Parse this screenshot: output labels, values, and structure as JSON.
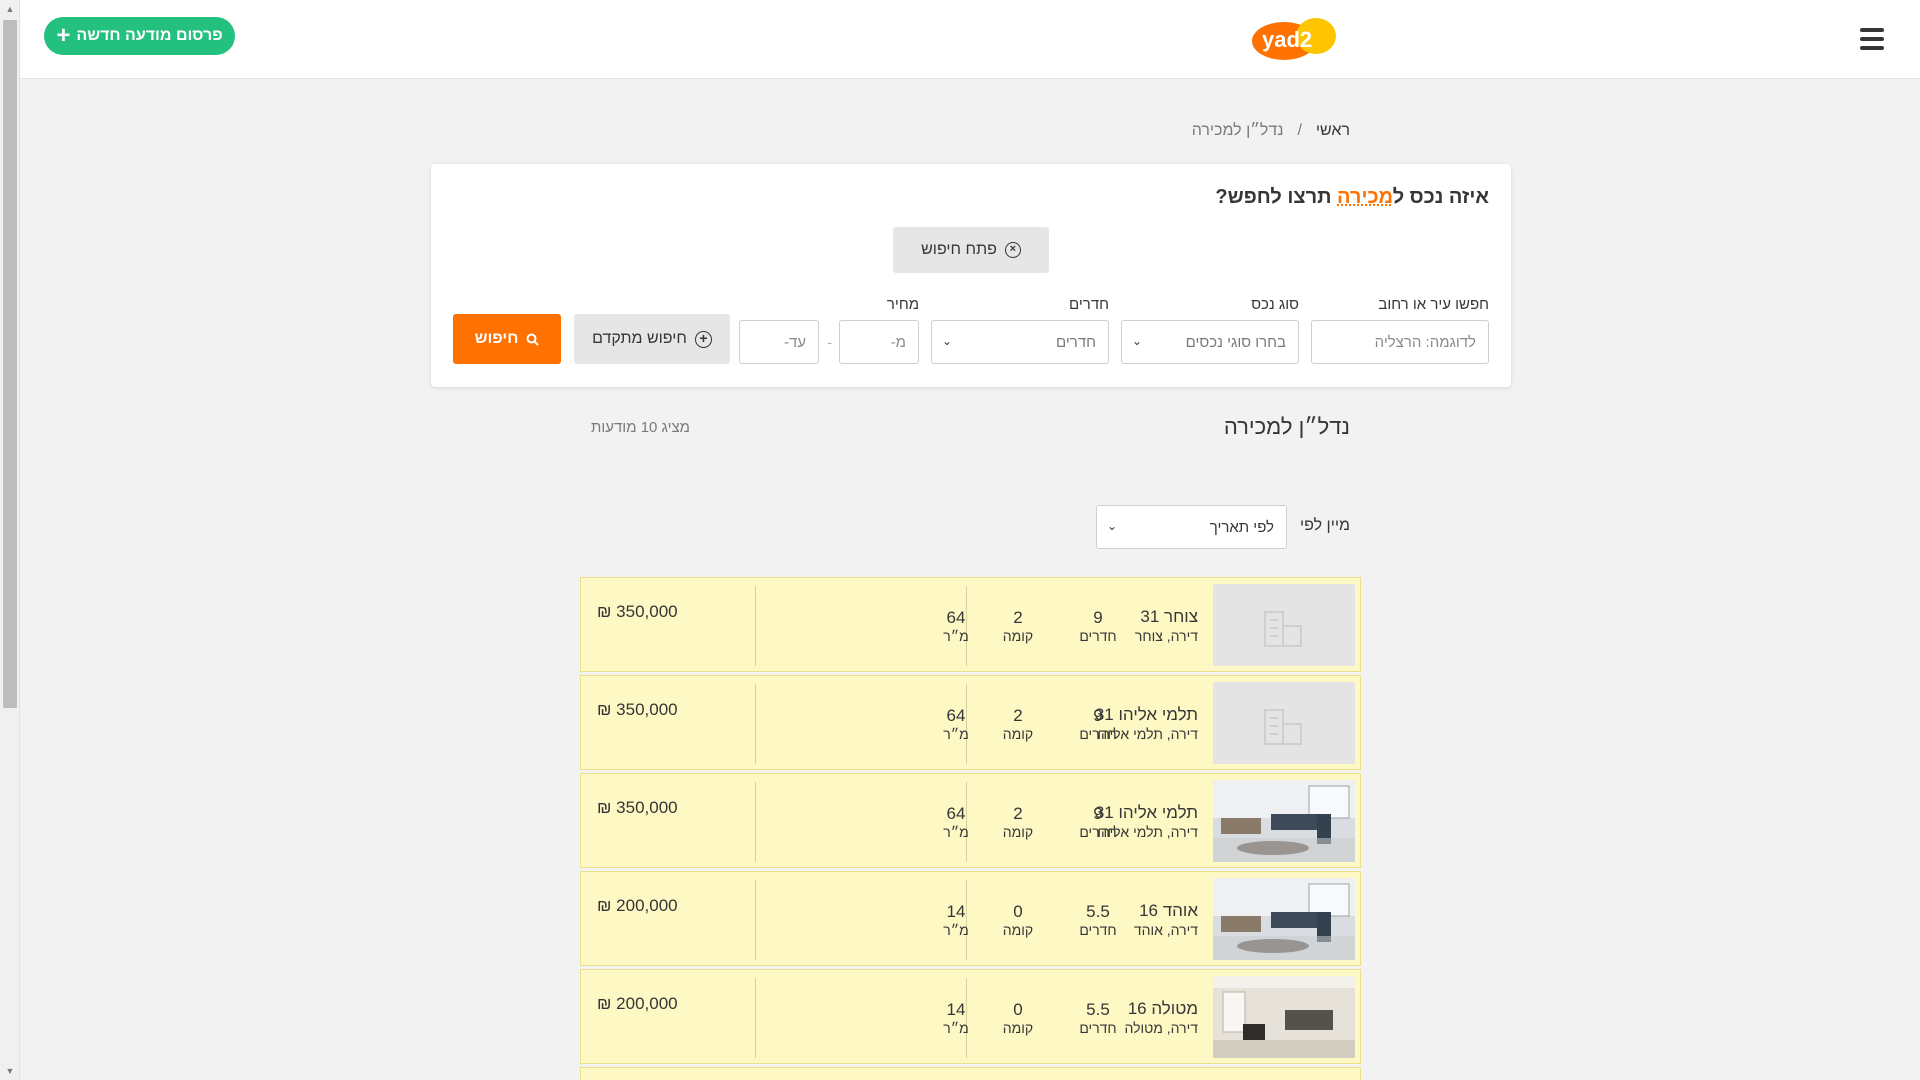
{
  "header": {
    "publish_label": "פרסום מודעה חדשה",
    "logo_text": "yad2"
  },
  "breadcrumb": {
    "home": "ראשי",
    "separator": "/",
    "current": "נדל״ן למכירה"
  },
  "search": {
    "title_prefix": "איזה נכס ל",
    "title_highlight": "מכירה",
    "title_suffix": " תרצו לחפש?",
    "open_search_label": "פתח חיפוש",
    "city_label": "חפשו עיר או רחוב",
    "city_placeholder": "לדוגמה: הרצליה",
    "type_label": "סוג נכס",
    "type_value": "בחרו סוגי נכסים",
    "rooms_label": "חדרים",
    "rooms_value": "חדרים",
    "price_label": "מחיר",
    "price_from_placeholder": "מ-",
    "price_to_placeholder": "עד-",
    "dash": "-",
    "advanced_label": "חיפוש מתקדם",
    "search_label": "חיפוש"
  },
  "results": {
    "title": "נדל״ן למכירה",
    "count_text": "מציג 10 מודעות",
    "sort_label": "מיין לפי",
    "sort_value": "לפי תאריך"
  },
  "labels": {
    "rooms": "חדרים",
    "floor": "קומה",
    "size": "מ״ר"
  },
  "listings": [
    {
      "title": "צוחר 31",
      "subtitle": "דירה, צוחר",
      "rooms": "9",
      "floor": "2",
      "size": "64",
      "price": "350,000 ₪",
      "image": "placeholder"
    },
    {
      "title": "תלמי אליהו 31",
      "subtitle": "דירה, תלמי אליהו",
      "rooms": "9",
      "floor": "2",
      "size": "64",
      "price": "350,000 ₪",
      "image": "placeholder"
    },
    {
      "title": "תלמי אליהו 31",
      "subtitle": "דירה, תלמי אליהו",
      "rooms": "9",
      "floor": "2",
      "size": "64",
      "price": "350,000 ₪",
      "image": "photo-living-room"
    },
    {
      "title": "אוהד 16",
      "subtitle": "דירה, אוהד",
      "rooms": "5.5",
      "floor": "0",
      "size": "14",
      "price": "200,000 ₪",
      "image": "photo-living-room"
    },
    {
      "title": "מטולה 16",
      "subtitle": "דירה, מטולה",
      "rooms": "5.5",
      "floor": "0",
      "size": "14",
      "price": "200,000 ₪",
      "image": "photo-room"
    }
  ],
  "colors": {
    "accent_orange": "#ff7100",
    "publish_green": "#23c07f",
    "listing_bg": "#fdf8c4"
  }
}
